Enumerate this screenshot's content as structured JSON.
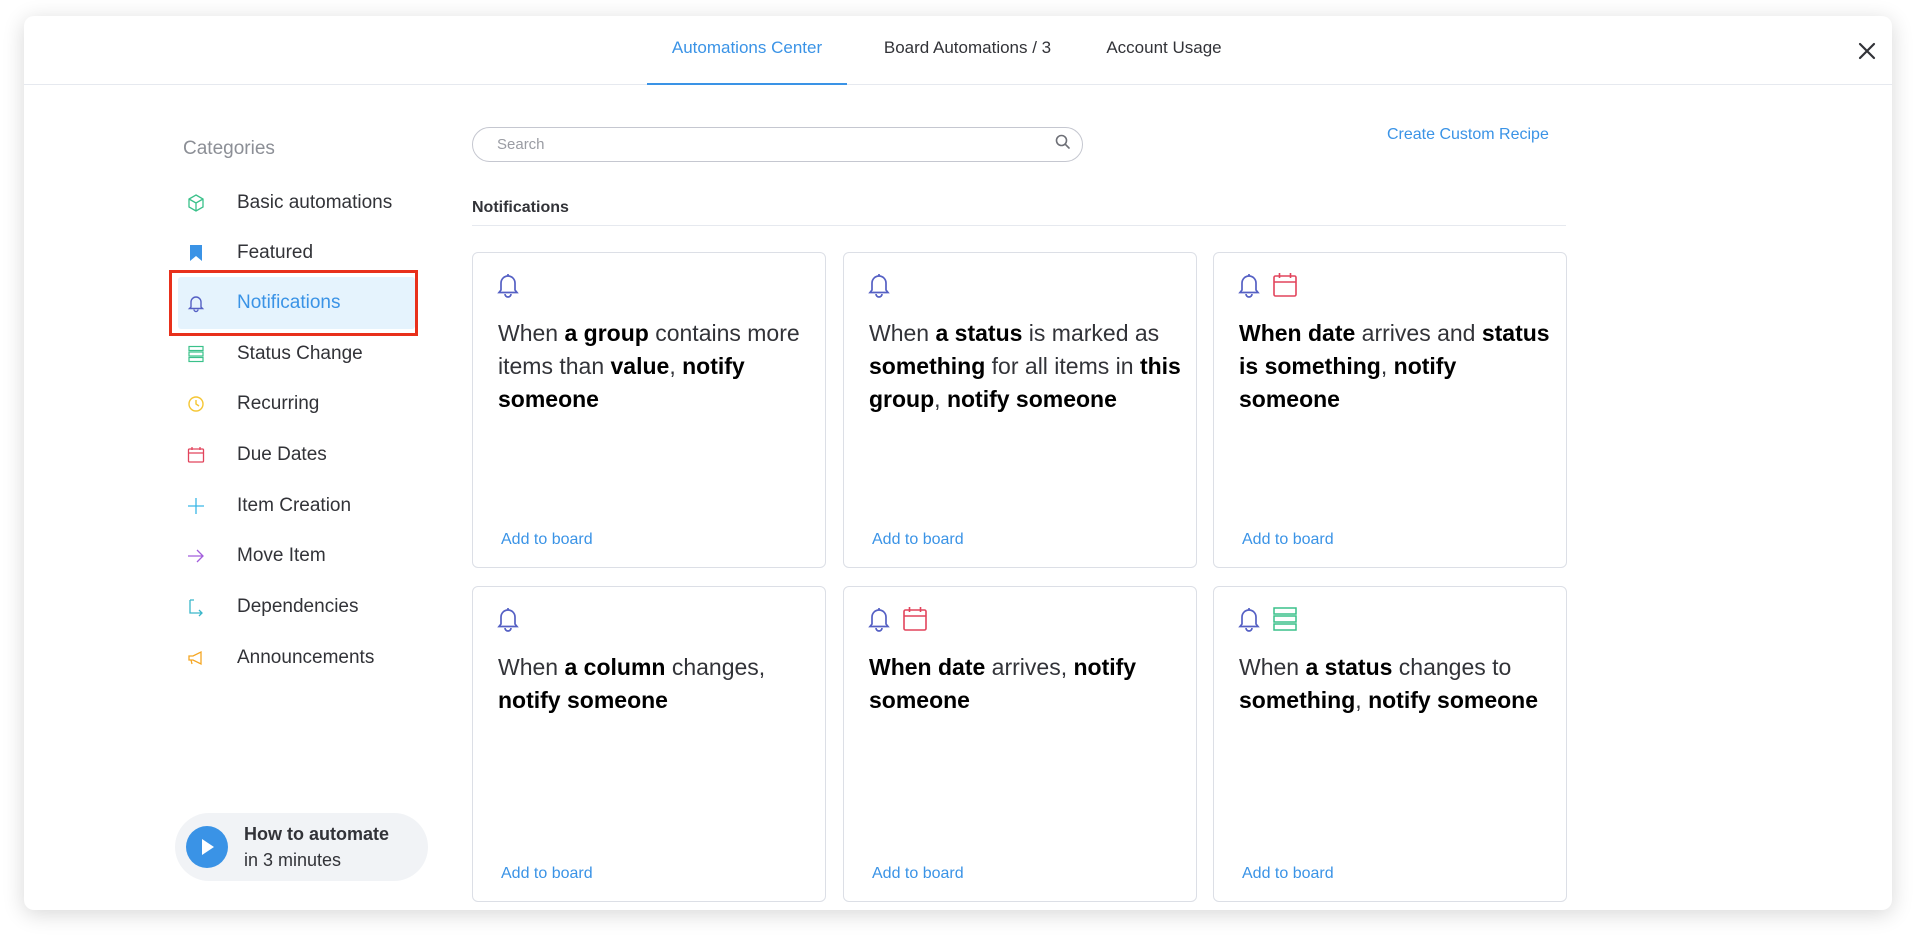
{
  "tabs": [
    {
      "label": "Automations Center"
    },
    {
      "label": "Board Automations / 3"
    },
    {
      "label": "Account Usage"
    }
  ],
  "sidebar": {
    "title": "Categories",
    "items": [
      {
        "label": "Basic automations",
        "icon": "cube-icon",
        "color": "#3ac18a"
      },
      {
        "label": "Featured",
        "icon": "bookmark-icon",
        "color": "#3a93e6"
      },
      {
        "label": "Notifications",
        "icon": "bell-icon",
        "color": "#5560c4"
      },
      {
        "label": "Status Change",
        "icon": "status-list-icon",
        "color": "#3ac18a"
      },
      {
        "label": "Recurring",
        "icon": "clock-icon",
        "color": "#f5c633"
      },
      {
        "label": "Due Dates",
        "icon": "calendar-icon",
        "color": "#e2445c"
      },
      {
        "label": "Item Creation",
        "icon": "plus-icon",
        "color": "#3ab6e6"
      },
      {
        "label": "Move Item",
        "icon": "arrow-right-icon",
        "color": "#a25ddc"
      },
      {
        "label": "Dependencies",
        "icon": "dependency-icon",
        "color": "#3ab6c9"
      },
      {
        "label": "Announcements",
        "icon": "megaphone-icon",
        "color": "#f5a623"
      }
    ]
  },
  "how_to": {
    "title": "How to automate",
    "subtitle": "in 3 minutes"
  },
  "search": {
    "placeholder": "Search"
  },
  "create_custom_recipe": "Create Custom Recipe",
  "section_title": "Notifications",
  "add_label": "Add to board",
  "cards": [
    {
      "icons": [
        "bell-icon"
      ],
      "parts": [
        [
          "When ",
          false
        ],
        [
          "a group",
          true
        ],
        [
          " contains more items than ",
          false
        ],
        [
          "value",
          true
        ],
        [
          ", ",
          false
        ],
        [
          "notify someone",
          true
        ]
      ]
    },
    {
      "icons": [
        "bell-icon"
      ],
      "parts": [
        [
          "When ",
          false
        ],
        [
          "a status",
          true
        ],
        [
          " is marked as ",
          false
        ],
        [
          "something",
          true
        ],
        [
          " for all items in ",
          false
        ],
        [
          "this group",
          true
        ],
        [
          ", ",
          false
        ],
        [
          "notify someone",
          true
        ]
      ]
    },
    {
      "icons": [
        "bell-icon",
        "calendar-icon"
      ],
      "parts": [
        [
          "When ",
          true
        ],
        [
          " date",
          true
        ],
        [
          " arrives and ",
          false
        ],
        [
          "status",
          true
        ],
        [
          " is ",
          true
        ],
        [
          " something",
          true
        ],
        [
          ", ",
          false
        ],
        [
          "notify someone",
          true
        ]
      ]
    },
    {
      "icons": [
        "bell-icon"
      ],
      "parts": [
        [
          "When ",
          false
        ],
        [
          "a column",
          true
        ],
        [
          " changes, ",
          false
        ],
        [
          "notify someone",
          true
        ]
      ]
    },
    {
      "icons": [
        "bell-icon",
        "calendar-icon"
      ],
      "parts": [
        [
          "When ",
          true
        ],
        [
          " date",
          true
        ],
        [
          " arrives, ",
          false
        ],
        [
          "notify someone",
          true
        ]
      ]
    },
    {
      "icons": [
        "bell-icon",
        "status-list-icon"
      ],
      "parts": [
        [
          "When ",
          false
        ],
        [
          "a status",
          true
        ],
        [
          " changes to ",
          false
        ],
        [
          "something",
          true
        ],
        [
          ", ",
          false
        ],
        [
          "notify someone",
          true
        ]
      ]
    }
  ],
  "colors": {
    "accent": "#3a93e6",
    "bell": "#5560c4",
    "calendar": "#e2445c",
    "status": "#3ac18a",
    "highlight": "#e8301b"
  }
}
